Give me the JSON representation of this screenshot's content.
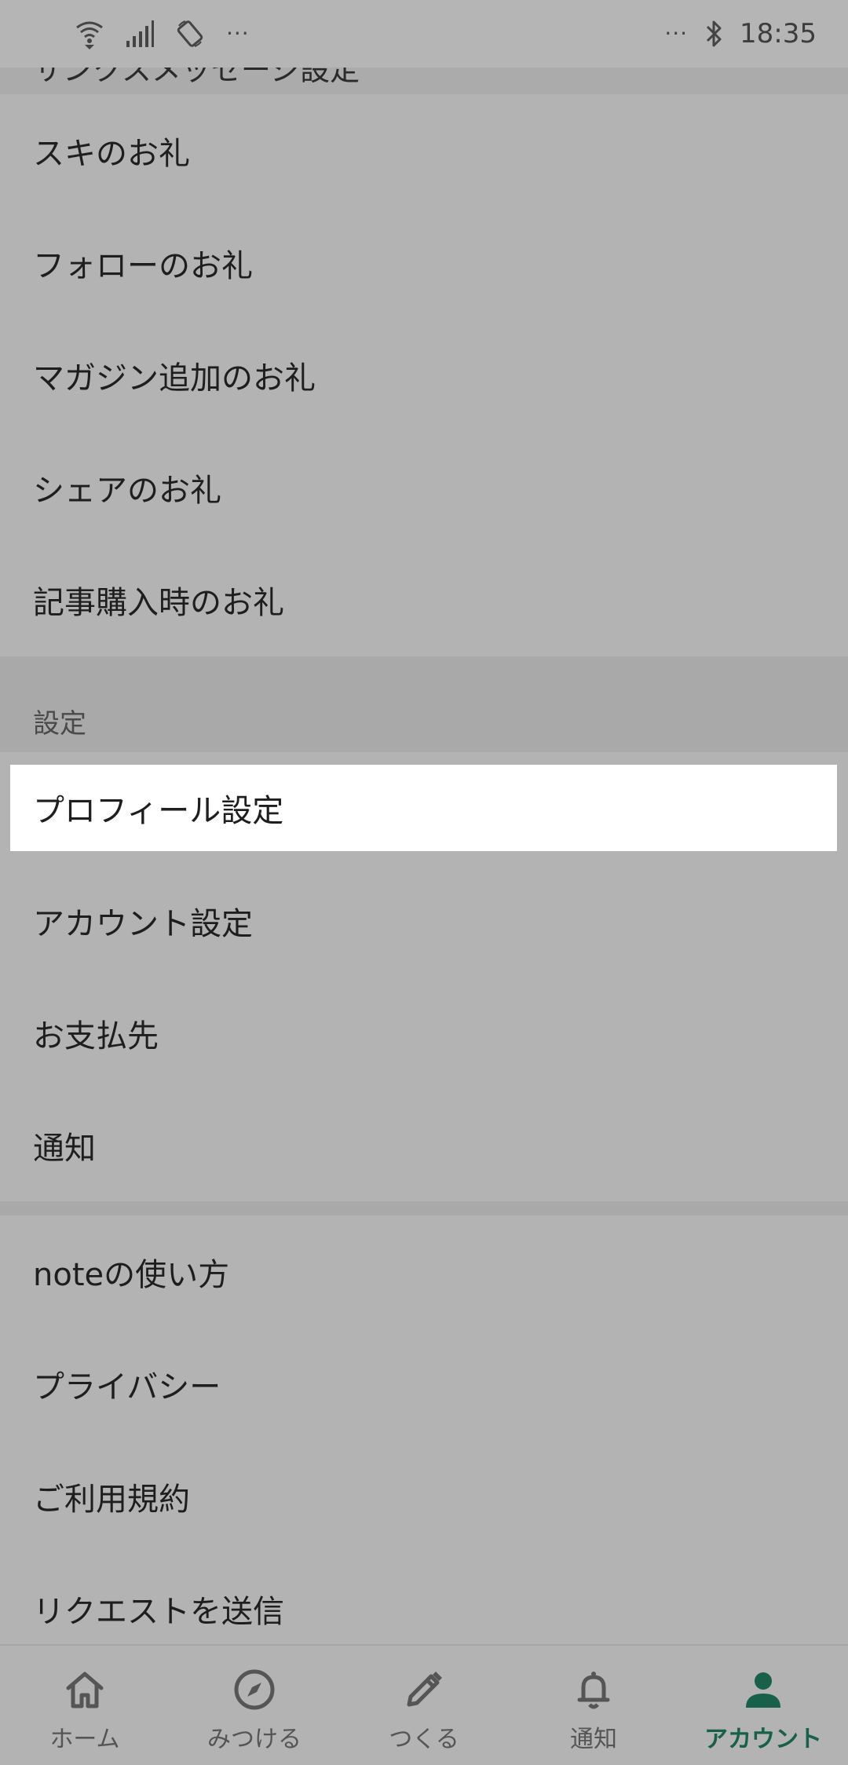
{
  "status_bar": {
    "left_dots": "···",
    "right_dots": "···",
    "time": "18:35"
  },
  "clipped_section_header": "サンクスメッセージ設定",
  "thanks_items": [
    {
      "label": "スキのお礼"
    },
    {
      "label": "フォローのお礼"
    },
    {
      "label": "マガジン追加のお礼"
    },
    {
      "label": "シェアのお礼"
    },
    {
      "label": "記事購入時のお礼"
    }
  ],
  "settings_header": "設定",
  "settings_items": [
    {
      "label": "プロフィール設定",
      "selected": true
    },
    {
      "label": "アカウント設定"
    },
    {
      "label": "お支払先"
    },
    {
      "label": "通知"
    }
  ],
  "info_items": [
    {
      "label": "noteの使い方"
    },
    {
      "label": "プライバシー"
    },
    {
      "label": "ご利用規約"
    },
    {
      "label": "リクエストを送信"
    }
  ],
  "bottom_nav": {
    "active_color": "#17604a",
    "tabs": [
      {
        "label": "ホーム",
        "icon": "home-icon"
      },
      {
        "label": "みつける",
        "icon": "compass-icon"
      },
      {
        "label": "つくる",
        "icon": "pencil-icon"
      },
      {
        "label": "通知",
        "icon": "bell-icon"
      },
      {
        "label": "アカウント",
        "icon": "person-icon",
        "active": true
      }
    ]
  }
}
